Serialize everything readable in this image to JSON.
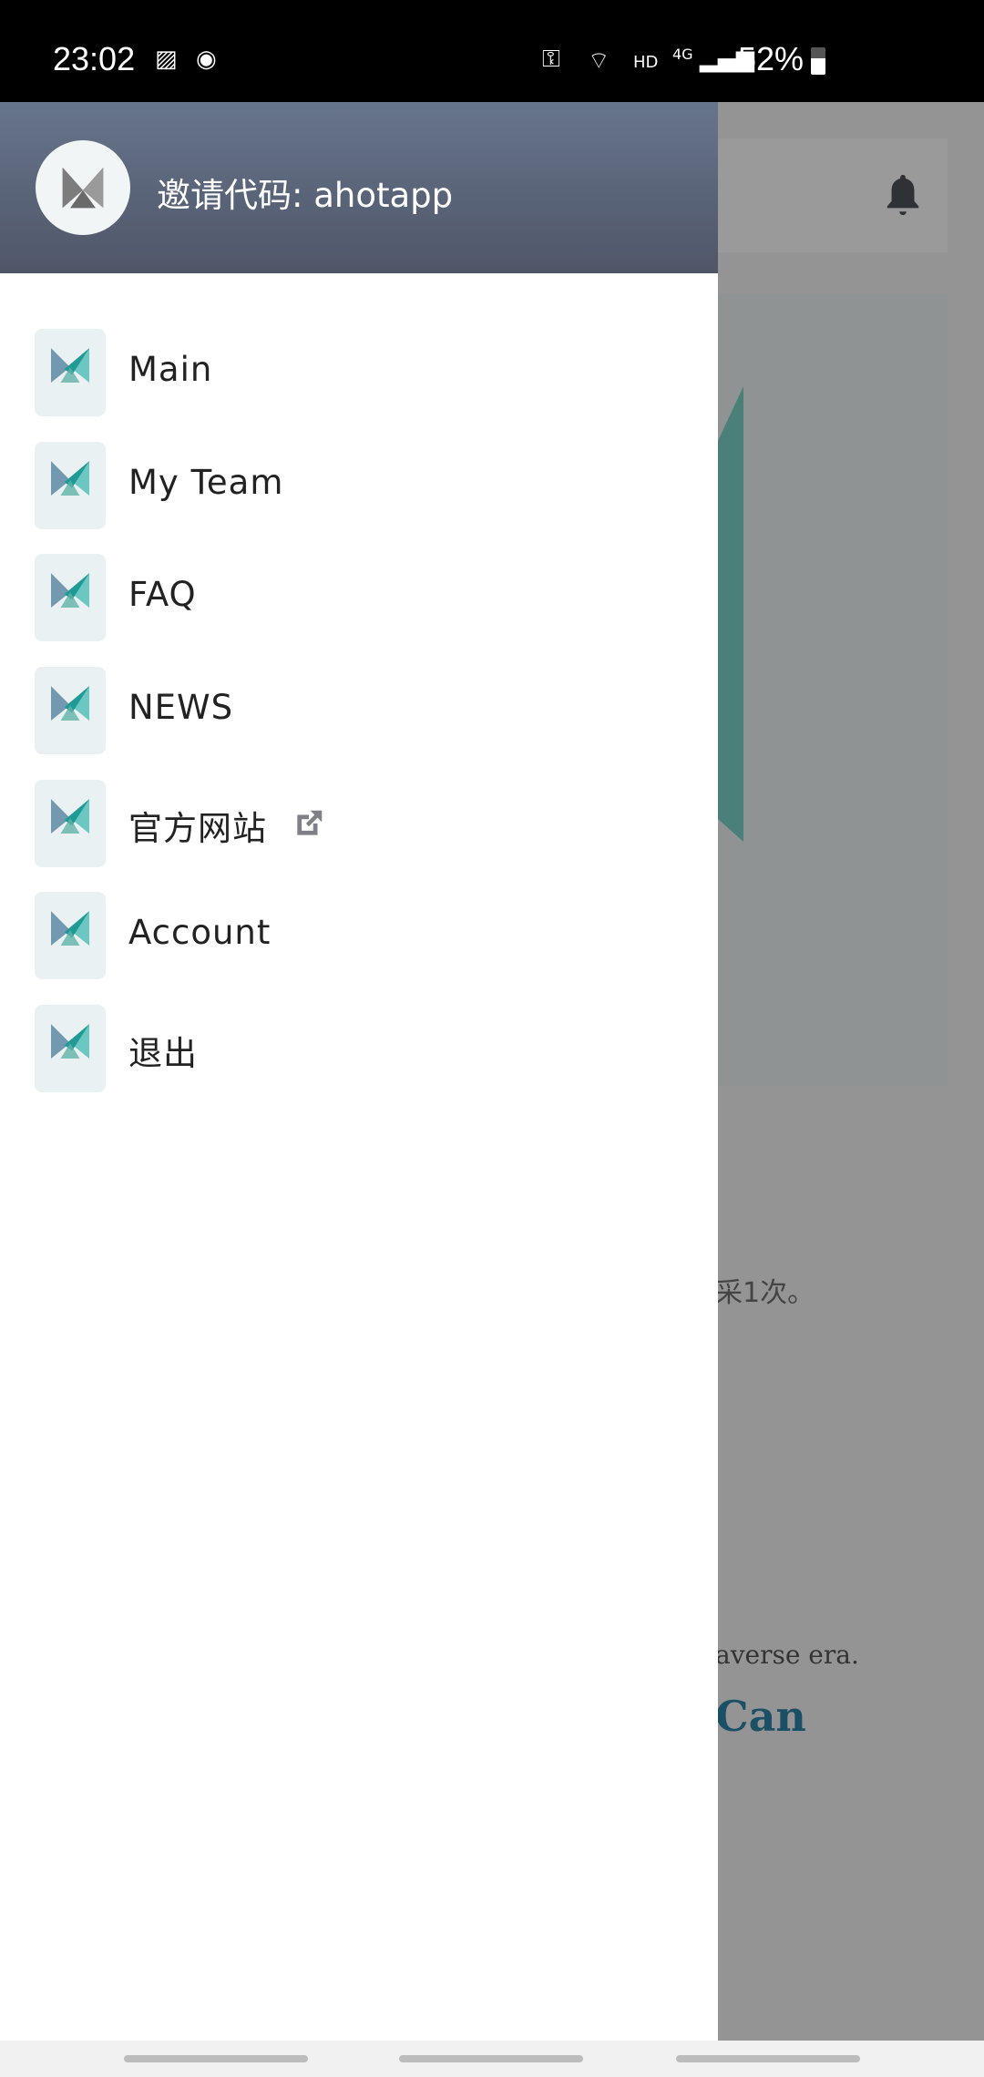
{
  "status_bar": {
    "time": "23:02",
    "battery": "52%",
    "network": "4G",
    "hd": "HD",
    "icons": [
      "gallery-icon",
      "app-icon",
      "vpn-key-icon",
      "wifi-icon",
      "signal-icon",
      "battery-icon"
    ]
  },
  "drawer": {
    "invite_text": "邀请代码: ahotapp",
    "items": [
      {
        "label": "Main",
        "icon": "app-logo-icon"
      },
      {
        "label": "My Team",
        "icon": "app-logo-icon"
      },
      {
        "label": "FAQ",
        "icon": "app-logo-icon"
      },
      {
        "label": "NEWS",
        "icon": "app-logo-icon"
      },
      {
        "label": "官方网站",
        "icon": "app-logo-icon",
        "external": true
      },
      {
        "label": "Account",
        "icon": "app-logo-icon"
      },
      {
        "label": "退出",
        "icon": "app-logo-icon"
      }
    ]
  },
  "background": {
    "text1": "采1次。",
    "text2": "averse era.",
    "text3": "Can"
  },
  "colors": {
    "header_top": "#67758c",
    "header_bottom": "#4f5668",
    "overlay": "#949494",
    "accent_teal": "#4a7f7a"
  }
}
